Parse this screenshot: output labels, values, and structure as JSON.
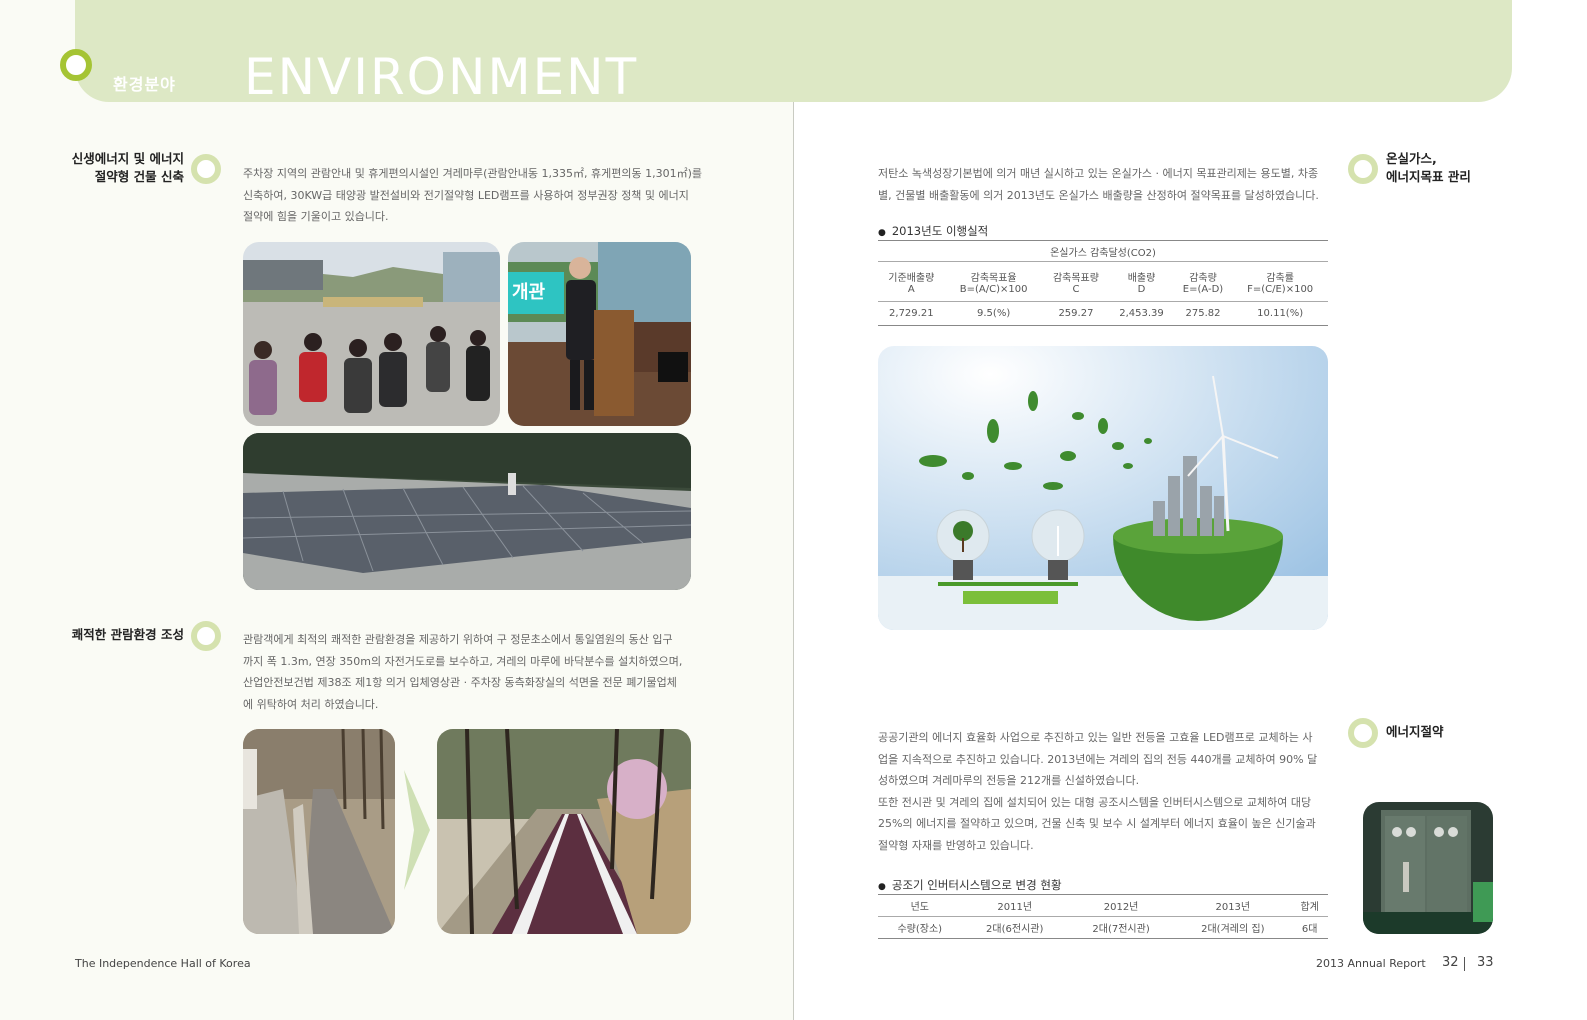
{
  "header": {
    "kr": "환경분야",
    "en": "ENVIRONMENT"
  },
  "left": {
    "sections": [
      {
        "title_lines": [
          "신생에너지 및 에너지",
          "절약형 건물 신축"
        ],
        "paragraph_lines": [
          "주차장 지역의 관람안내 및 휴게편의시설인 겨레마루(관람안내동 1,335㎡, 휴게편의동 1,301㎡)를",
          "신축하여, 30KW급 태양광 발전설비와 전기절약형 LED램프를 사용하여 정부권장 정책 및 에너지",
          "절약에 힘을 기울이고 있습니다."
        ]
      },
      {
        "title_lines": [
          "쾌적한 관람환경 조성"
        ],
        "paragraph_lines": [
          "관람객에게 최적의 쾌적한 관람환경을 제공하기 위하여  구 정문초소에서 통일염원의 동산 입구",
          "까지 폭 1.3m, 연장 350m의 자전거도로를 보수하고, 겨레의 마루에 바닥분수를 설치하였으며,",
          "산업안전보건법 제38조 제1항 의거 입체영상관 · 주차장 동측화장실의 석면을 전문 폐기물업체",
          "에 위탁하여 처리 하였습니다."
        ]
      }
    ],
    "sign_text": "개관"
  },
  "right": {
    "sections": [
      {
        "title_lines": [
          "온실가스,",
          "에너지목표 관리"
        ],
        "paragraph_lines": [
          "저탄소 녹색성장기본법에 의거 매년 실시하고 있는 온실가스 · 에너지 목표관리제는 용도별, 차종",
          "별, 건물별 배출활동에 의거 2013년도 온실가스 배출량을 산정하여 절약목표를 달성하였습니다."
        ]
      },
      {
        "title_lines": [
          "에너지절약"
        ],
        "paragraph_lines": [
          "공공기관의 에너지 효율화 사업으로 추진하고 있는 일반 전등을 고효율 LED램프로 교체하는 사",
          "업을 지속적으로 추진하고 있습니다. 2013년에는 겨레의 집의 전등 440개를 교체하여 90% 달",
          "성하였으며 겨레마루의 전등을 212개를 신설하였습니다.",
          "또한 전시관 및 겨레의 집에 설치되어 있는 대형 공조시스템을 인버터시스템으로 교체하여 대당",
          "25%의 에너지를 절약하고 있으며, 건물 신축 및 보수 시 설계부터 에너지 효율이 높은 신기술과",
          "절약형 자재를 반영하고 있습니다."
        ]
      }
    ],
    "table1": {
      "bullet": "2013년도 이행실적",
      "caption": "온실가스 감축달성(CO2)",
      "headers": [
        [
          "기준배출량",
          "A"
        ],
        [
          "감축목표율",
          "B=(A/C)×100"
        ],
        [
          "감축목표량",
          "C"
        ],
        [
          "배출량",
          "D"
        ],
        [
          "감축량",
          "E=(A-D)"
        ],
        [
          "감축률",
          "F=(C/E)×100"
        ]
      ],
      "values": [
        "2,729.21",
        "9.5(%)",
        "259.27",
        "2,453.39",
        "275.82",
        "10.11(%)"
      ]
    },
    "table2": {
      "bullet": "공조기 인버터시스템으로 변경 현황",
      "headers": [
        "년도",
        "2011년",
        "2012년",
        "2013년",
        "합계"
      ],
      "row": [
        "수량(장소)",
        "2대(6전시관)",
        "2대(7전시관)",
        "2대(겨레의 집)",
        "6대"
      ]
    }
  },
  "footer": {
    "left": "The Independence Hall of Korea",
    "right": "2013 Annual Report",
    "page_left": "32",
    "page_right": "33"
  }
}
